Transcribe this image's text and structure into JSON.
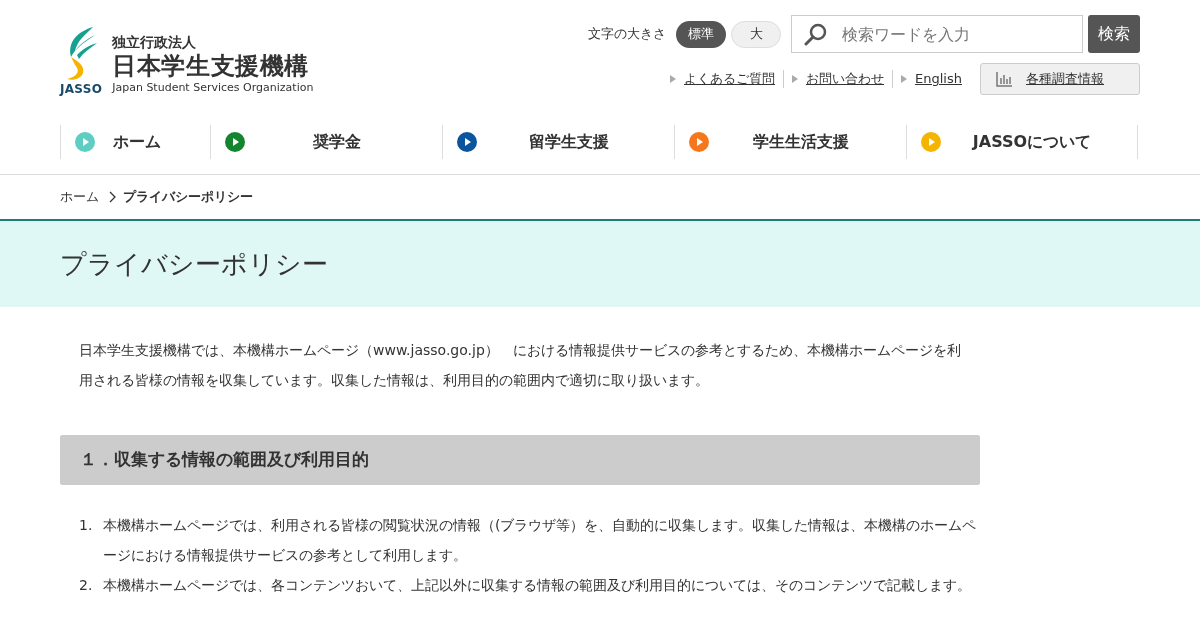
{
  "logo": {
    "org_type": "独立行政法人",
    "name": "日本学生支援機構",
    "abbr": "JASSO",
    "english": "Japan Student Services Organization"
  },
  "font_size": {
    "label": "文字の大きさ",
    "options": [
      {
        "label": "標準",
        "selected": true
      },
      {
        "label": "大",
        "selected": false
      }
    ]
  },
  "search": {
    "placeholder": "検索ワードを入力",
    "button": "検索"
  },
  "utility_links": [
    {
      "label": "よくあるご質問"
    },
    {
      "label": "お問い合わせ"
    },
    {
      "label": "English"
    }
  ],
  "survey_button": "各種調査情報",
  "nav": [
    {
      "label": "ホーム",
      "color": "#5ecec3"
    },
    {
      "label": "奨学金",
      "color": "#14852f"
    },
    {
      "label": "留学生支援",
      "color": "#0b559f"
    },
    {
      "label": "学生生活支援",
      "color": "#f6761b"
    },
    {
      "label": "JASSOについて",
      "color": "#f5b400"
    }
  ],
  "breadcrumb": [
    {
      "label": "ホーム",
      "current": false
    },
    {
      "label": "プライバシーポリシー",
      "current": true
    }
  ],
  "page_title": "プライバシーポリシー",
  "intro": "日本学生支援機構では、本機構ホームページ（www.jasso.go.jp）　における情報提供サービスの参考とするため、本機構ホームページを利用される皆様の情報を収集しています。収集した情報は、利用目的の範囲内で適切に取り扱います。",
  "sections": [
    {
      "heading": "１．収集する情報の範囲及び利用目的",
      "items": [
        {
          "number": "1.",
          "text": "本機構ホームページでは、利用される皆様の閲覧状況の情報（(ブラウザ等）を、自動的に収集します。収集した情報は、本機構のホームページにおける情報提供サービスの参考として利用します。"
        },
        {
          "number": "2.",
          "text": "本機構ホームページでは、各コンテンツおいて、上記以外に収集する情報の範囲及び利用目的については、そのコンテンツで記載します。"
        }
      ]
    }
  ]
}
